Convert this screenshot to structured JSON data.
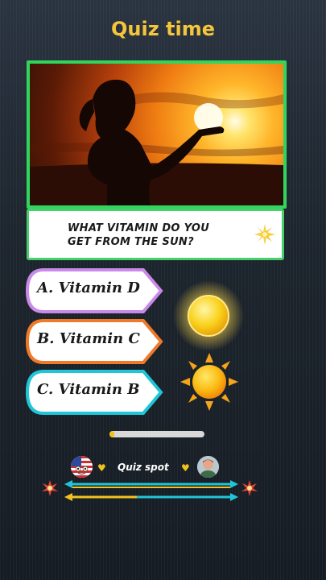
{
  "header": {
    "title": "Quiz time"
  },
  "question": {
    "text": "WHAT VITAMIN DO YOU GET FROM THE SUN?"
  },
  "options": [
    {
      "letter": "A.",
      "text": "Vitamin D",
      "label": "A.  Vitamin D",
      "border_color": "#c98ae8"
    },
    {
      "letter": "B.",
      "text": "Vitamin C",
      "label": "B.  Vitamin C",
      "border_color": "#f07a2a"
    },
    {
      "letter": "C.",
      "text": "Vitamin B",
      "label": "C.  Vitamin B",
      "border_color": "#1ec6d8"
    }
  ],
  "timer": {
    "progress": 0.05,
    "fill_color": "#f2c21c"
  },
  "footer": {
    "brand": "Quiz spot",
    "heart_left": "♥",
    "heart_right": "♥"
  },
  "colors": {
    "title": "#f5c53b",
    "frame_border": "#2fd65b",
    "arrow_cyan": "#1ec6d8",
    "arrow_yellow": "#f2c21c"
  },
  "icons": [
    "sparkle-icon",
    "glowing-sun-icon",
    "sun-icon",
    "us-flag-icon",
    "heart-icon",
    "person-avatar-icon",
    "burst-icon",
    "double-arrow-icon"
  ]
}
